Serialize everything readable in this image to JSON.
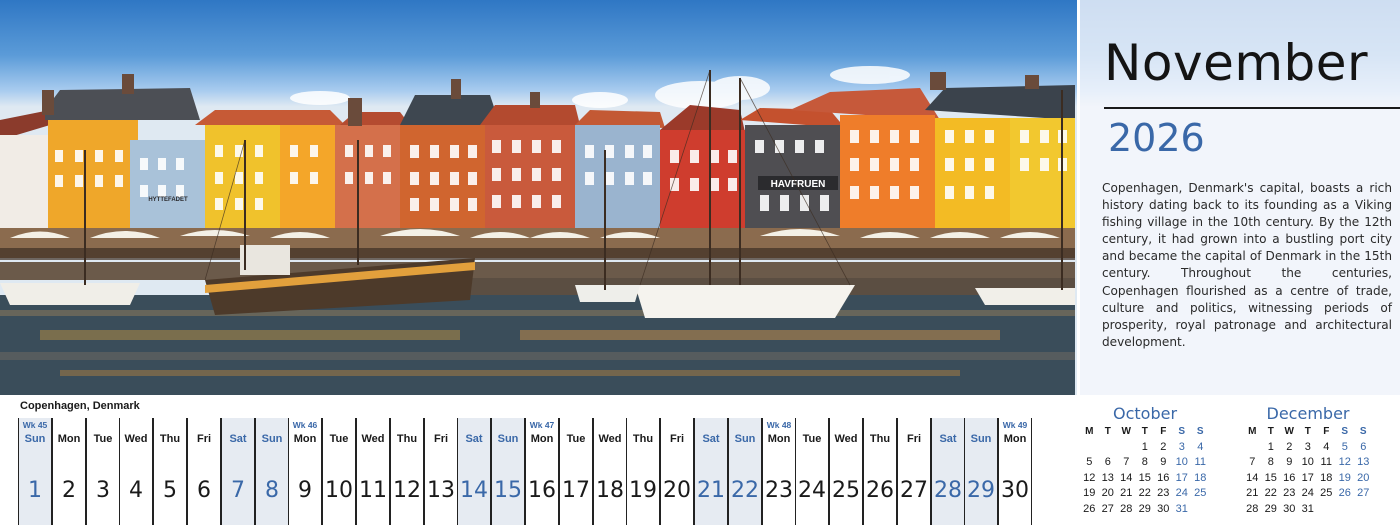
{
  "header": {
    "month": "November",
    "year": "2026",
    "description": "Copenhagen, Denmark's capital, boasts a rich history dating back to its founding as a Viking fishing village in the 10th century. By the 12th century, it had grown into a bustling port city and became the capital of Denmark in the 15th century. Throughout the centuries, Copenhagen flourished as a centre of trade, culture and politics, witnessing periods of prosperity, royal patronage and architectural development."
  },
  "photo": {
    "location_caption": "Copenhagen, Denmark",
    "shop_sign_1": "HAVFRUEN",
    "shop_sign_2": "HYTTEFADET"
  },
  "days": [
    {
      "wk": "Wk 45",
      "dow": "Sun",
      "num": "1",
      "weekend": true
    },
    {
      "wk": "",
      "dow": "Mon",
      "num": "2",
      "weekend": false
    },
    {
      "wk": "",
      "dow": "Tue",
      "num": "3",
      "weekend": false
    },
    {
      "wk": "",
      "dow": "Wed",
      "num": "4",
      "weekend": false
    },
    {
      "wk": "",
      "dow": "Thu",
      "num": "5",
      "weekend": false
    },
    {
      "wk": "",
      "dow": "Fri",
      "num": "6",
      "weekend": false
    },
    {
      "wk": "",
      "dow": "Sat",
      "num": "7",
      "weekend": true
    },
    {
      "wk": "",
      "dow": "Sun",
      "num": "8",
      "weekend": true
    },
    {
      "wk": "Wk 46",
      "dow": "Mon",
      "num": "9",
      "weekend": false
    },
    {
      "wk": "",
      "dow": "Tue",
      "num": "10",
      "weekend": false
    },
    {
      "wk": "",
      "dow": "Wed",
      "num": "11",
      "weekend": false
    },
    {
      "wk": "",
      "dow": "Thu",
      "num": "12",
      "weekend": false
    },
    {
      "wk": "",
      "dow": "Fri",
      "num": "13",
      "weekend": false
    },
    {
      "wk": "",
      "dow": "Sat",
      "num": "14",
      "weekend": true
    },
    {
      "wk": "",
      "dow": "Sun",
      "num": "15",
      "weekend": true
    },
    {
      "wk": "Wk 47",
      "dow": "Mon",
      "num": "16",
      "weekend": false
    },
    {
      "wk": "",
      "dow": "Tue",
      "num": "17",
      "weekend": false
    },
    {
      "wk": "",
      "dow": "Wed",
      "num": "18",
      "weekend": false
    },
    {
      "wk": "",
      "dow": "Thu",
      "num": "19",
      "weekend": false
    },
    {
      "wk": "",
      "dow": "Fri",
      "num": "20",
      "weekend": false
    },
    {
      "wk": "",
      "dow": "Sat",
      "num": "21",
      "weekend": true
    },
    {
      "wk": "",
      "dow": "Sun",
      "num": "22",
      "weekend": true
    },
    {
      "wk": "Wk 48",
      "dow": "Mon",
      "num": "23",
      "weekend": false
    },
    {
      "wk": "",
      "dow": "Tue",
      "num": "24",
      "weekend": false
    },
    {
      "wk": "",
      "dow": "Wed",
      "num": "25",
      "weekend": false
    },
    {
      "wk": "",
      "dow": "Thu",
      "num": "26",
      "weekend": false
    },
    {
      "wk": "",
      "dow": "Fri",
      "num": "27",
      "weekend": false
    },
    {
      "wk": "",
      "dow": "Sat",
      "num": "28",
      "weekend": true
    },
    {
      "wk": "",
      "dow": "Sun",
      "num": "29",
      "weekend": true
    },
    {
      "wk": "Wk 49",
      "dow": "Mon",
      "num": "30",
      "weekend": false
    }
  ],
  "mini_calendars": [
    {
      "title": "October",
      "headers": [
        "M",
        "T",
        "W",
        "T",
        "F",
        "S",
        "S"
      ],
      "cells": [
        "",
        "",
        "",
        "1",
        "2",
        "3",
        "4",
        "5",
        "6",
        "7",
        "8",
        "9",
        "10",
        "11",
        "12",
        "13",
        "14",
        "15",
        "16",
        "17",
        "18",
        "19",
        "20",
        "21",
        "22",
        "23",
        "24",
        "25",
        "26",
        "27",
        "28",
        "29",
        "30",
        "31",
        ""
      ]
    },
    {
      "title": "December",
      "headers": [
        "M",
        "T",
        "W",
        "T",
        "F",
        "S",
        "S"
      ],
      "cells": [
        "",
        "1",
        "2",
        "3",
        "4",
        "5",
        "6",
        "7",
        "8",
        "9",
        "10",
        "11",
        "12",
        "13",
        "14",
        "15",
        "16",
        "17",
        "18",
        "19",
        "20",
        "21",
        "22",
        "23",
        "24",
        "25",
        "26",
        "27",
        "28",
        "29",
        "30",
        "31",
        "",
        "",
        ""
      ]
    }
  ],
  "colors": {
    "accent_blue": "#3a68a8",
    "weekend_bg": "#e6ebf2",
    "text": "#1a1a1a"
  }
}
